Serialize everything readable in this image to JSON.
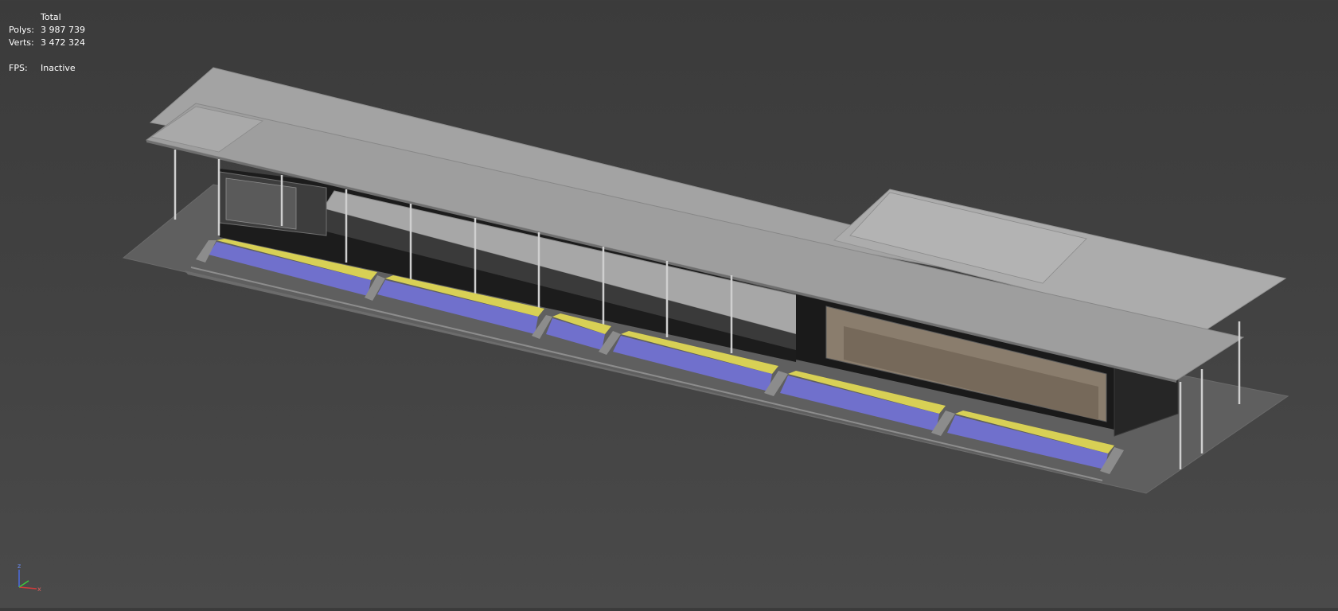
{
  "viewport": {
    "name": "3D perspective viewport",
    "background_top": "#3b3b3b",
    "background_bottom": "#4a4a4a",
    "scene": "sports stadium grandstand with canopy roof and indoor hall",
    "seat_colors": {
      "upper": "#d8d055",
      "lower": "#7070cc"
    }
  },
  "stats": {
    "header": "Total",
    "polys_label": "Polys:",
    "polys_value": "3 987 739",
    "verts_label": "Verts:",
    "verts_value": "3 472 324",
    "fps_label": "FPS:",
    "fps_value": "Inactive"
  },
  "axis_gizmo": {
    "z_label": "z",
    "x_label": "x",
    "x_color": "#d23c3c",
    "y_color": "#3cc83c",
    "z_color": "#4a6ae0"
  }
}
